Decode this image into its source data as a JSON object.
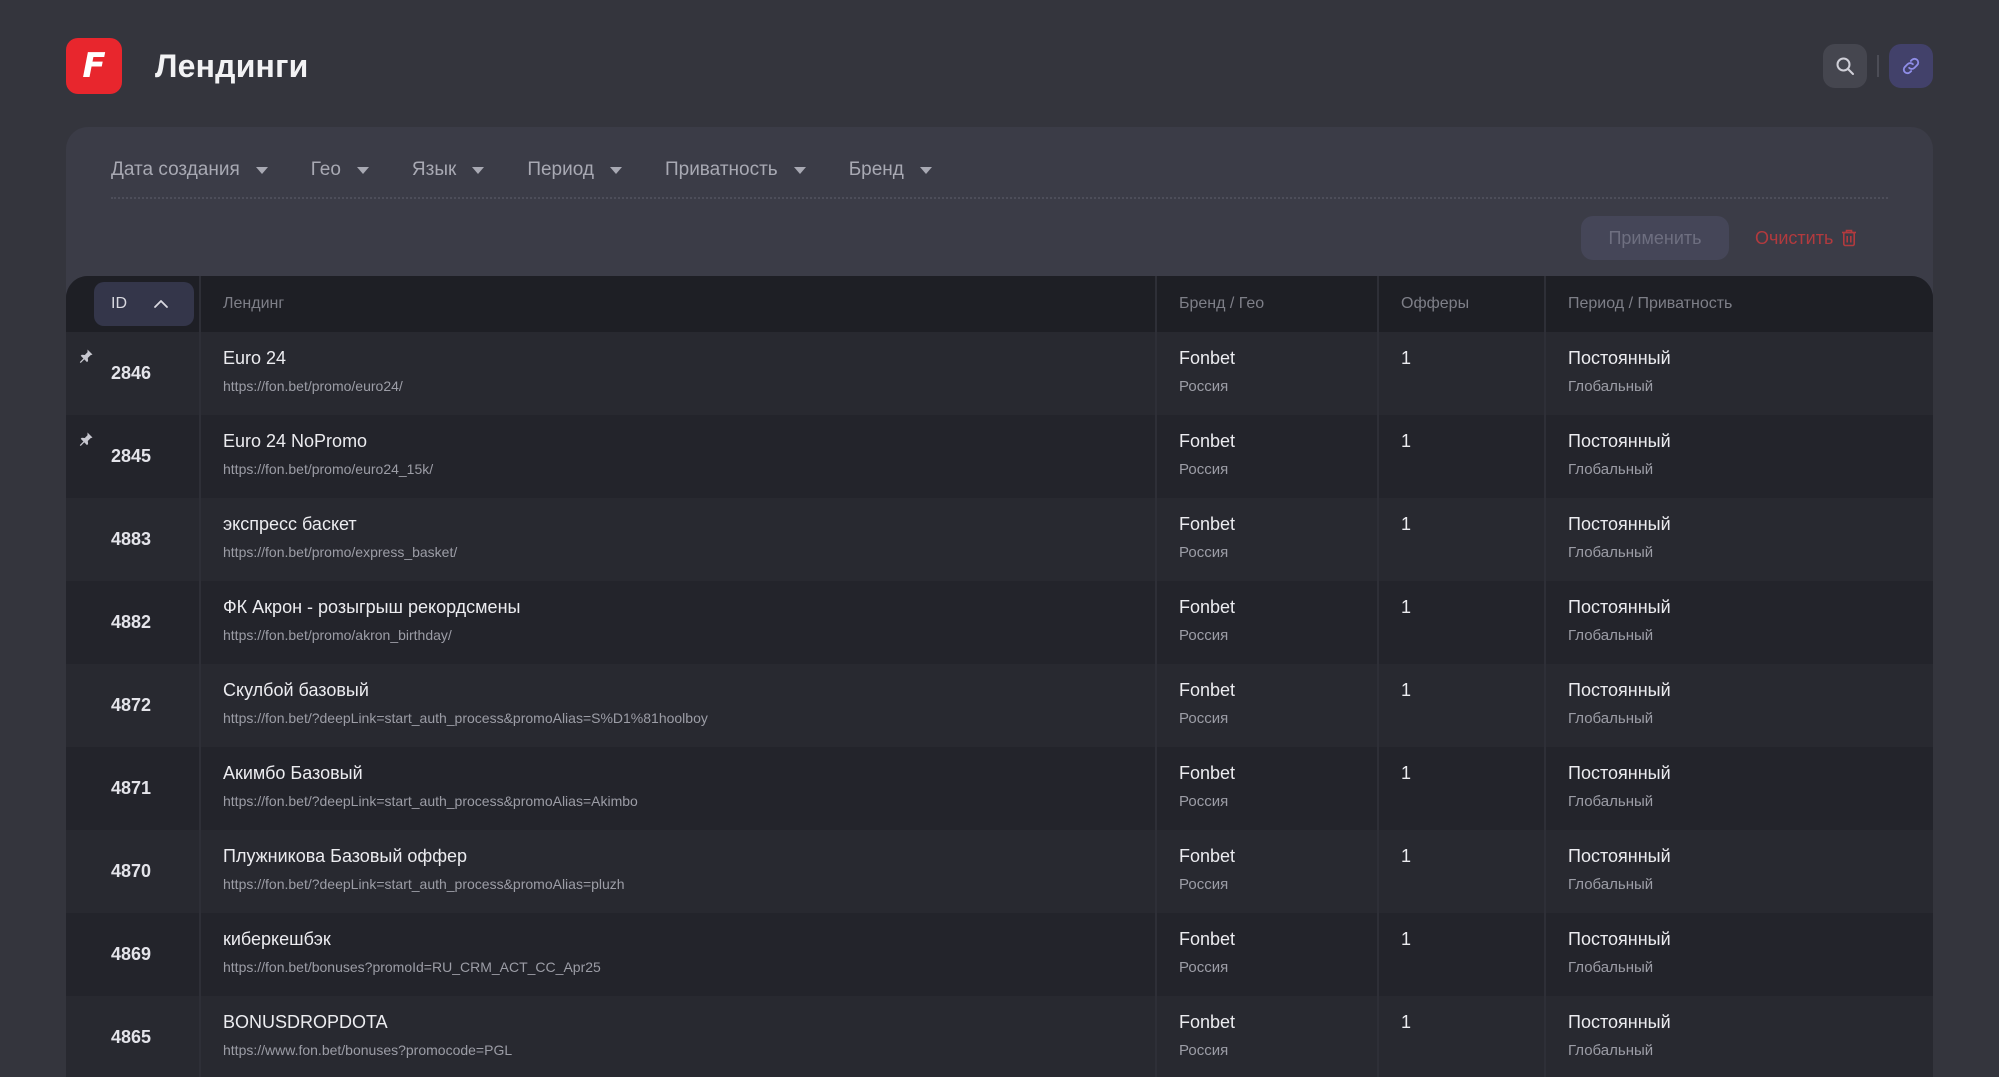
{
  "header": {
    "logo_letter": "F",
    "title": "Лендинги"
  },
  "filters": {
    "items": [
      "Дата создания",
      "Гео",
      "Язык",
      "Период",
      "Приватность",
      "Бренд"
    ],
    "apply_label": "Применить",
    "clear_label": "Очистить"
  },
  "table": {
    "headers": {
      "id": "ID",
      "landing": "Лендинг",
      "brand_geo": "Бренд / Гео",
      "offers": "Офферы",
      "period_privacy": "Период / Приватность"
    },
    "rows": [
      {
        "id": "2846",
        "pinned": true,
        "name": "Euro 24",
        "url": "https://fon.bet/promo/euro24/",
        "brand": "Fonbet",
        "geo": "Россия",
        "offers": "1",
        "period": "Постоянный",
        "privacy": "Глобальный"
      },
      {
        "id": "2845",
        "pinned": true,
        "name": "Euro 24 NoPromo",
        "url": "https://fon.bet/promo/euro24_15k/",
        "brand": "Fonbet",
        "geo": "Россия",
        "offers": "1",
        "period": "Постоянный",
        "privacy": "Глобальный"
      },
      {
        "id": "4883",
        "pinned": false,
        "name": "экспресс баскет",
        "url": "https://fon.bet/promo/express_basket/",
        "brand": "Fonbet",
        "geo": "Россия",
        "offers": "1",
        "period": "Постоянный",
        "privacy": "Глобальный"
      },
      {
        "id": "4882",
        "pinned": false,
        "name": "ФК Акрон - розыгрыш рекордсмены",
        "url": "https://fon.bet/promo/akron_birthday/",
        "brand": "Fonbet",
        "geo": "Россия",
        "offers": "1",
        "period": "Постоянный",
        "privacy": "Глобальный"
      },
      {
        "id": "4872",
        "pinned": false,
        "name": "Скулбой базовый",
        "url": "https://fon.bet/?deepLink=start_auth_process&promoAlias=S%D1%81hoolboy",
        "brand": "Fonbet",
        "geo": "Россия",
        "offers": "1",
        "period": "Постоянный",
        "privacy": "Глобальный"
      },
      {
        "id": "4871",
        "pinned": false,
        "name": "Акимбо Базовый",
        "url": "https://fon.bet/?deepLink=start_auth_process&promoAlias=Akimbo",
        "brand": "Fonbet",
        "geo": "Россия",
        "offers": "1",
        "period": "Постоянный",
        "privacy": "Глобальный"
      },
      {
        "id": "4870",
        "pinned": false,
        "name": "Плужникова Базовый оффер",
        "url": "https://fon.bet/?deepLink=start_auth_process&promoAlias=pluzh",
        "brand": "Fonbet",
        "geo": "Россия",
        "offers": "1",
        "period": "Постоянный",
        "privacy": "Глобальный"
      },
      {
        "id": "4869",
        "pinned": false,
        "name": "киберкешбэк",
        "url": "https://fon.bet/bonuses?promoId=RU_CRM_ACT_CC_Apr25",
        "brand": "Fonbet",
        "geo": "Россия",
        "offers": "1",
        "period": "Постоянный",
        "privacy": "Глобальный"
      },
      {
        "id": "4865",
        "pinned": false,
        "name": "BONUSDROPDOTA",
        "url": "https://www.fon.bet/bonuses?promocode=PGL",
        "brand": "Fonbet",
        "geo": "Россия",
        "offers": "1",
        "period": "Постоянный",
        "privacy": "Глобальный"
      }
    ]
  }
}
